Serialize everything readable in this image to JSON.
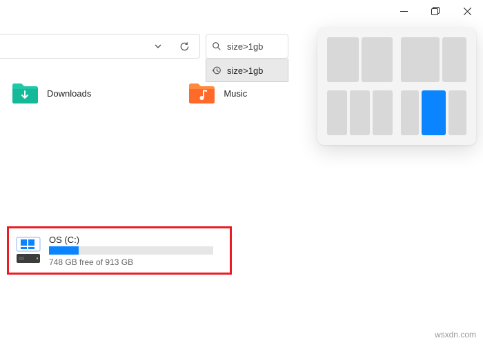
{
  "window_controls": {
    "minimize": "Minimize",
    "maximize": "Maximize",
    "close": "Close"
  },
  "toolbar": {
    "search_query": "size>1gb",
    "search_suggestion": "size>1gb"
  },
  "folders": [
    {
      "name": "Downloads",
      "icon": "downloads-folder"
    },
    {
      "name": "Music",
      "icon": "music-folder"
    }
  ],
  "drive": {
    "name": "OS (C:)",
    "free_gb": 748,
    "total_gb": 913,
    "status": "748 GB free of 913 GB",
    "used_percent": 18
  },
  "snap_layouts": {
    "groups": [
      {
        "id": "two-equal",
        "zones": [
          "a",
          "b"
        ]
      },
      {
        "id": "two-wide-right",
        "zones": [
          "a",
          "b"
        ]
      },
      {
        "id": "three-equal",
        "zones": [
          "a",
          "b",
          "c"
        ]
      },
      {
        "id": "left-plus-stack",
        "zones": [
          "a",
          "b",
          "c"
        ],
        "selected_index": 1
      }
    ]
  },
  "branding": {
    "watermark": "wsxdn.com"
  }
}
